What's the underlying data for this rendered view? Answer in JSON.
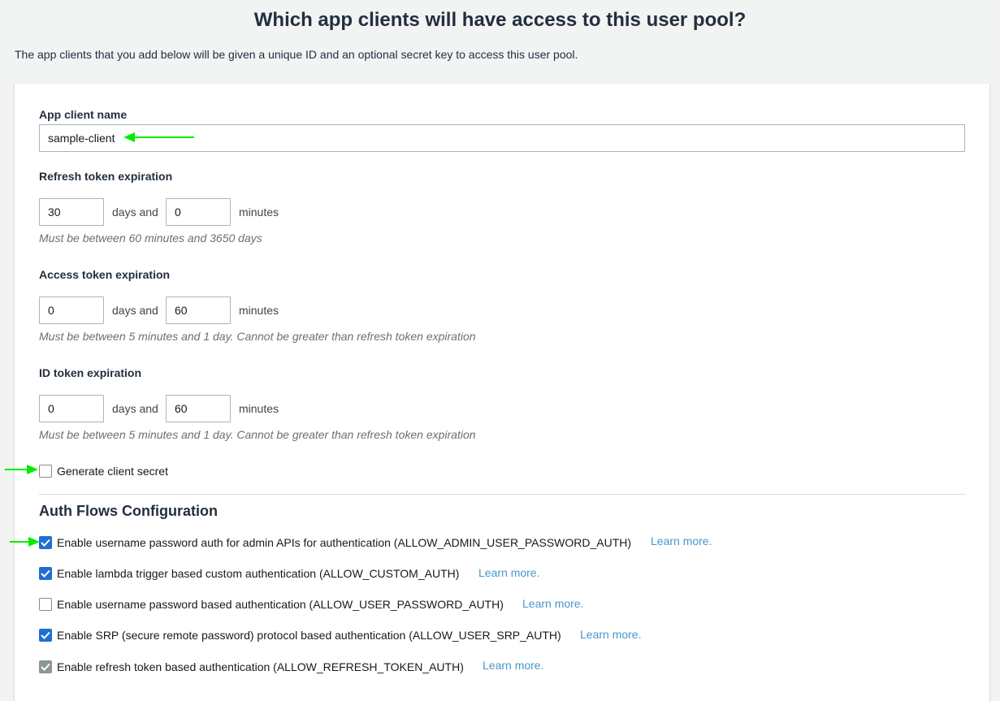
{
  "header": {
    "title": "Which app clients will have access to this user pool?",
    "description": "The app clients that you add below will be given a unique ID and an optional secret key to access this user pool."
  },
  "client_name": {
    "label": "App client name",
    "value": "sample-client"
  },
  "refresh_token": {
    "label": "Refresh token expiration",
    "days": "30",
    "days_suffix": "days and",
    "minutes": "0",
    "minutes_suffix": "minutes",
    "hint": "Must be between 60 minutes and 3650 days"
  },
  "access_token": {
    "label": "Access token expiration",
    "days": "0",
    "days_suffix": "days and",
    "minutes": "60",
    "minutes_suffix": "minutes",
    "hint": "Must be between 5 minutes and 1 day. Cannot be greater than refresh token expiration"
  },
  "id_token": {
    "label": "ID token expiration",
    "days": "0",
    "days_suffix": "days and",
    "minutes": "60",
    "minutes_suffix": "minutes",
    "hint": "Must be between 5 minutes and 1 day. Cannot be greater than refresh token expiration"
  },
  "client_secret": {
    "label": "Generate client secret",
    "checked": false
  },
  "auth_flows": {
    "title": "Auth Flows Configuration",
    "learn_more": "Learn more.",
    "items": [
      {
        "label": "Enable username password auth for admin APIs for authentication (ALLOW_ADMIN_USER_PASSWORD_AUTH)",
        "checked": true
      },
      {
        "label": "Enable lambda trigger based custom authentication (ALLOW_CUSTOM_AUTH)",
        "checked": true
      },
      {
        "label": "Enable username password based authentication (ALLOW_USER_PASSWORD_AUTH)",
        "checked": false
      },
      {
        "label": "Enable SRP (secure remote password) protocol based authentication (ALLOW_USER_SRP_AUTH)",
        "checked": true
      },
      {
        "label": "Enable refresh token based authentication (ALLOW_REFRESH_TOKEN_AUTH)",
        "checked": true,
        "disabled": true
      }
    ]
  },
  "colors": {
    "accent": "#1f6fd1",
    "link": "#4796cc",
    "annotation_arrow": "#00ee00",
    "background": "#f2f3f3"
  },
  "icons": {
    "checkmark": "checkmark-icon",
    "arrow": "green-arrow-icon"
  }
}
